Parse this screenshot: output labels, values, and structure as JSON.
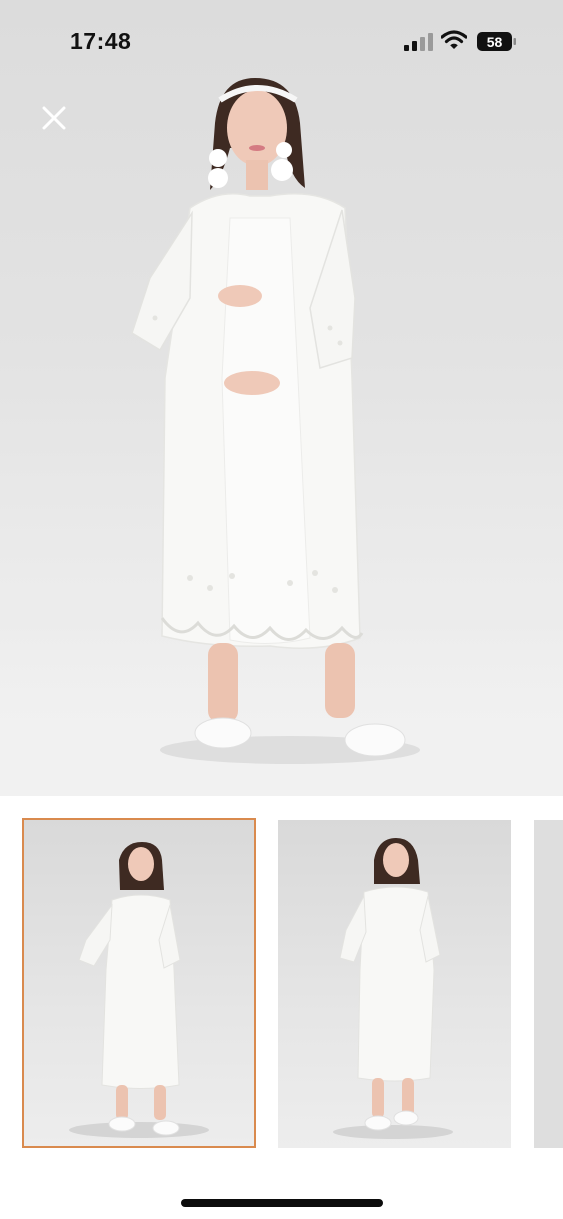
{
  "status_bar": {
    "time": "17:48",
    "battery_level": "58",
    "icons": [
      "signal-icon",
      "wifi-icon",
      "battery-icon"
    ]
  },
  "viewer": {
    "close_icon": "close-icon",
    "main_image": "model-white-robe-photo"
  },
  "thumbnails": [
    {
      "name": "thumbnail-1",
      "selected": true
    },
    {
      "name": "thumbnail-2",
      "selected": false
    },
    {
      "name": "thumbnail-3",
      "selected": false
    }
  ],
  "colors": {
    "selected_border": "#d98a4e",
    "text": "#111111",
    "background": "#ffffff"
  }
}
